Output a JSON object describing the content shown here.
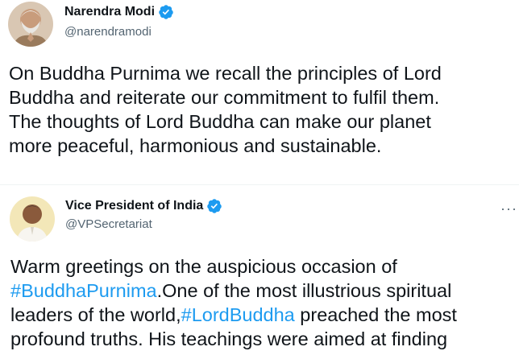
{
  "colors": {
    "verified_badge": "#1d9bf0",
    "hashtag": "#1d9bf0",
    "secondary_text": "#536471",
    "primary_text": "#0f1419"
  },
  "tweets": [
    {
      "author": {
        "display_name": "Narendra Modi",
        "handle": "@narendramodi",
        "verified": true,
        "avatar_icon": "avatar-photo"
      },
      "text_lines": [
        "On Buddha Purnima we recall the principles of Lord",
        "Buddha and reiterate our commitment to fulfil them.",
        "The thoughts of Lord Buddha can make our planet",
        "more peaceful, harmonious and sustainable."
      ]
    },
    {
      "author": {
        "display_name": "Vice President of India",
        "handle": "@VPSecretariat",
        "verified": true,
        "avatar_icon": "avatar-photo"
      },
      "more_icon": "more-options-icon",
      "more_label": "···",
      "text": {
        "line1": "Warm greetings on the auspicious occasion of",
        "line2_hashtag": "#BuddhaPurnima",
        "line2_rest": ".One of the most illustrious spiritual",
        "line3_start": "leaders of the world,",
        "line3_hashtag": "#LordBuddha",
        "line3_rest": " preached the most",
        "line4": "profound truths. His teachings were aimed at finding"
      }
    }
  ]
}
